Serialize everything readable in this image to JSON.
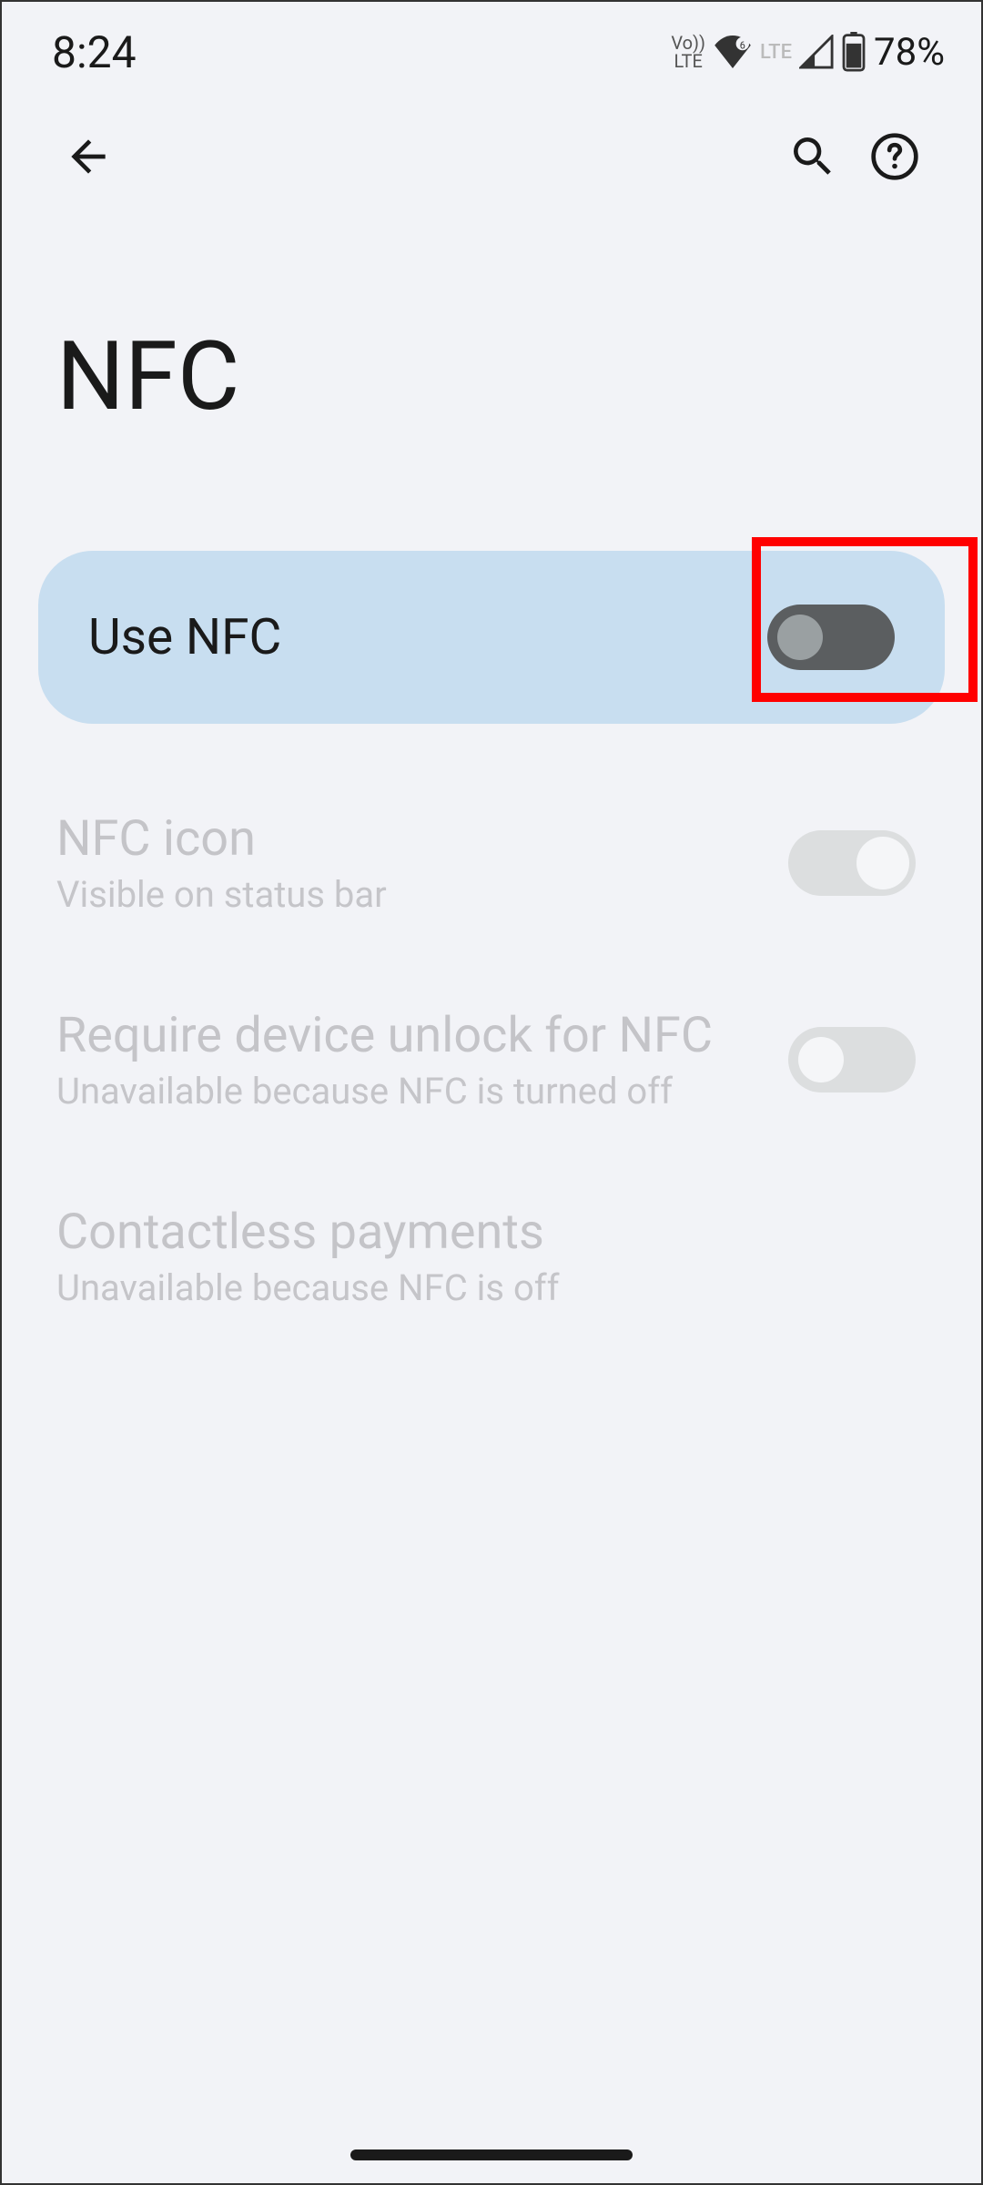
{
  "status_bar": {
    "time": "8:24",
    "volte_line1": "Vo))",
    "volte_line2": "LTE",
    "lte_secondary": "LTE",
    "battery_percent": "78%"
  },
  "header": {
    "title": "NFC"
  },
  "primary_toggle": {
    "label": "Use NFC",
    "state": "off"
  },
  "settings": [
    {
      "title": "NFC icon",
      "subtitle": "Visible on status bar",
      "toggle_state": "disabled-on",
      "disabled": true
    },
    {
      "title": "Require device unlock for NFC",
      "subtitle": "Unavailable because NFC is turned off",
      "toggle_state": "disabled-off",
      "disabled": true
    },
    {
      "title": "Contactless payments",
      "subtitle": "Unavailable because NFC is off",
      "toggle_state": "none",
      "disabled": true
    }
  ]
}
